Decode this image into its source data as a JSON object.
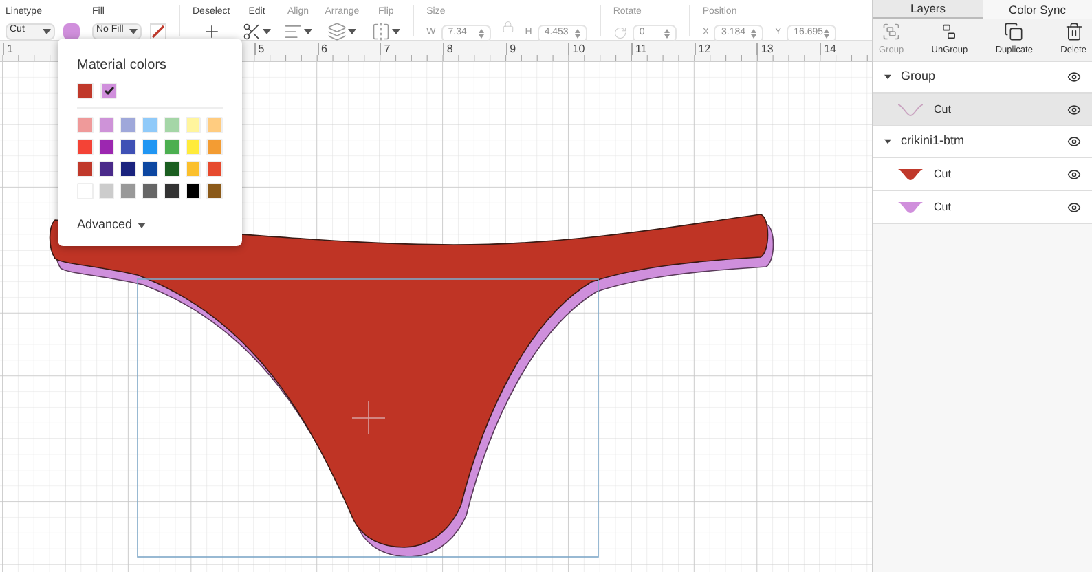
{
  "toolbar": {
    "linetype": {
      "label": "Linetype",
      "value": "Cut",
      "color": "#d08fdc"
    },
    "fill": {
      "label": "Fill",
      "value": "No Fill"
    },
    "actions": [
      {
        "label": "Deselect",
        "kind": "deselect",
        "disabled": false
      },
      {
        "label": "Edit",
        "kind": "edit",
        "disabled": false
      },
      {
        "label": "Align",
        "kind": "align",
        "disabled": true
      },
      {
        "label": "Arrange",
        "kind": "arrange",
        "disabled": true
      },
      {
        "label": "Flip",
        "kind": "flip",
        "disabled": true
      }
    ],
    "size": {
      "label": "Size",
      "disabled": true,
      "w": {
        "label": "W",
        "value": "7.34"
      },
      "h": {
        "label": "H",
        "value": "4.453"
      }
    },
    "rotate": {
      "label": "Rotate",
      "value": "0",
      "disabled": true
    },
    "position": {
      "label": "Position",
      "disabled": true,
      "x": {
        "label": "X",
        "value": "3.184"
      },
      "y": {
        "label": "Y",
        "value": "16.695"
      }
    }
  },
  "ruler": [
    "1",
    "5",
    "6",
    "7",
    "8",
    "9",
    "10",
    "11",
    "12",
    "13",
    "14"
  ],
  "color_popup": {
    "title": "Material colors",
    "recent": [
      {
        "color": "#c0392b",
        "selected": false
      },
      {
        "color": "#d08fdc",
        "selected": true
      }
    ],
    "palette": [
      [
        {
          "color": "#ef9a9a"
        },
        {
          "color": "#ce93d8"
        },
        {
          "color": "#9fa8da"
        },
        {
          "color": "#90caf9"
        },
        {
          "color": "#a5d6a7"
        },
        {
          "color": "#fff59d"
        },
        {
          "color": "#ffcc80"
        }
      ],
      [
        {
          "color": "#f44336"
        },
        {
          "color": "#9c27b0"
        },
        {
          "color": "#3f51b5"
        },
        {
          "color": "#2196f3"
        },
        {
          "color": "#4caf50"
        },
        {
          "color": "#ffeb3b"
        },
        {
          "color": "#f39c33"
        }
      ],
      [
        {
          "color": "#c0392b"
        },
        {
          "color": "#4a2a8a"
        },
        {
          "color": "#1a237e"
        },
        {
          "color": "#0d47a1"
        },
        {
          "color": "#1b5e20"
        },
        {
          "color": "#fbc02d"
        },
        {
          "color": "#e64a2e"
        }
      ],
      [
        {
          "color": "#ffffff"
        },
        {
          "color": "#cccccc"
        },
        {
          "color": "#999999"
        },
        {
          "color": "#666666"
        },
        {
          "color": "#333333"
        },
        {
          "color": "#000000"
        },
        {
          "color": "#8b5a1a"
        }
      ]
    ],
    "advanced": "Advanced"
  },
  "panel": {
    "tabs": [
      {
        "label": "Layers",
        "selected": true
      },
      {
        "label": "Color Sync",
        "selected": false
      }
    ],
    "tools": [
      {
        "label": "Group",
        "kind": "group",
        "disabled": true
      },
      {
        "label": "UnGroup",
        "kind": "ungroup",
        "disabled": false
      },
      {
        "label": "Duplicate",
        "kind": "duplicate",
        "disabled": false
      },
      {
        "label": "Delete",
        "kind": "delete",
        "disabled": false
      }
    ],
    "layers": [
      {
        "name": "Group",
        "expanded": true,
        "children": [
          {
            "name": "Cut",
            "kind": "outline",
            "color": "#c9a3c0",
            "selected": true
          }
        ]
      },
      {
        "name": "crikini1-btm",
        "expanded": true,
        "children": [
          {
            "name": "Cut",
            "kind": "filled",
            "color": "#c0392b",
            "selected": false
          },
          {
            "name": "Cut",
            "kind": "filled",
            "color": "#d08fdc",
            "selected": false
          }
        ]
      }
    ]
  }
}
